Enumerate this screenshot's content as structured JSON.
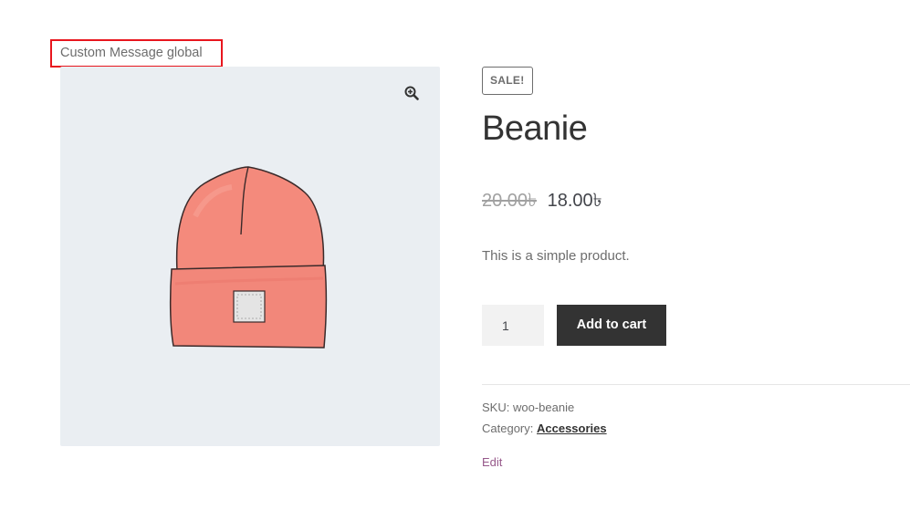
{
  "custom_message": "Custom Message global",
  "gallery": {
    "zoom_icon": "zoom-in-magnifier-icon",
    "image_icon": "beanie-product-image"
  },
  "product": {
    "badge": "SALE!",
    "title": "Beanie",
    "price_old": "20.00৳",
    "price_new": "18.00৳",
    "short_description": "This is a simple product."
  },
  "cart_form": {
    "quantity": "1",
    "add_to_cart_label": "Add to cart"
  },
  "meta": {
    "sku_label": "SKU:",
    "sku_value": "woo-beanie",
    "category_label": "Category:",
    "category_value": "Accessories"
  },
  "edit_label": "Edit",
  "colors": {
    "message_border": "#e8161e",
    "button_bg": "#333333",
    "gallery_bg": "#eaeef2",
    "edit_link": "#96588a",
    "beanie": "#f4877a"
  }
}
